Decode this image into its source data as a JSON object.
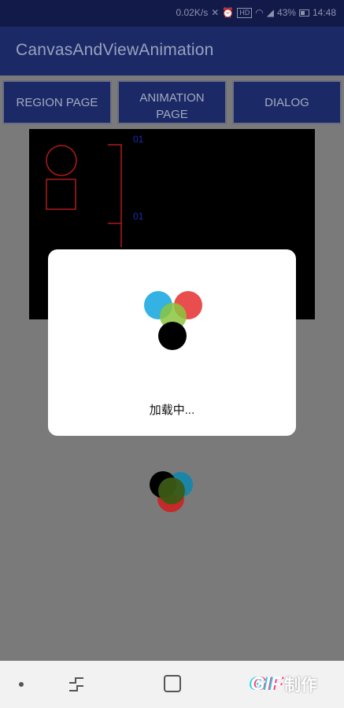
{
  "status_bar": {
    "speed": "0.02K/s",
    "network_badge": "HD",
    "battery_percent": "43%",
    "time": "14:48",
    "icons": [
      "mute-icon",
      "alarm-icon",
      "wifi-icon",
      "signal-icon",
      "battery-icon"
    ]
  },
  "app_bar": {
    "title": "CanvasAndViewAnimation"
  },
  "tabs": [
    {
      "label": "REGION PAGE"
    },
    {
      "label_line1": "ANIMATION",
      "label_line2": "PAGE"
    },
    {
      "label": "DIALOG"
    }
  ],
  "canvas": {
    "label_top": "01",
    "label_mid": "01",
    "stroke_color": "#b01a1a"
  },
  "dialog": {
    "message": "加载中..."
  },
  "nav_bar": {
    "watermark_logo": "GIF",
    "watermark_text": "制作"
  },
  "colors": {
    "appbar": "#1b2a66",
    "statusbar": "#121a4a",
    "scrim": "#7a7a7a",
    "spinner_blue": "#29aee3",
    "spinner_red": "#e83a3a",
    "spinner_green": "#7ab82a",
    "spinner_black": "#000000"
  }
}
